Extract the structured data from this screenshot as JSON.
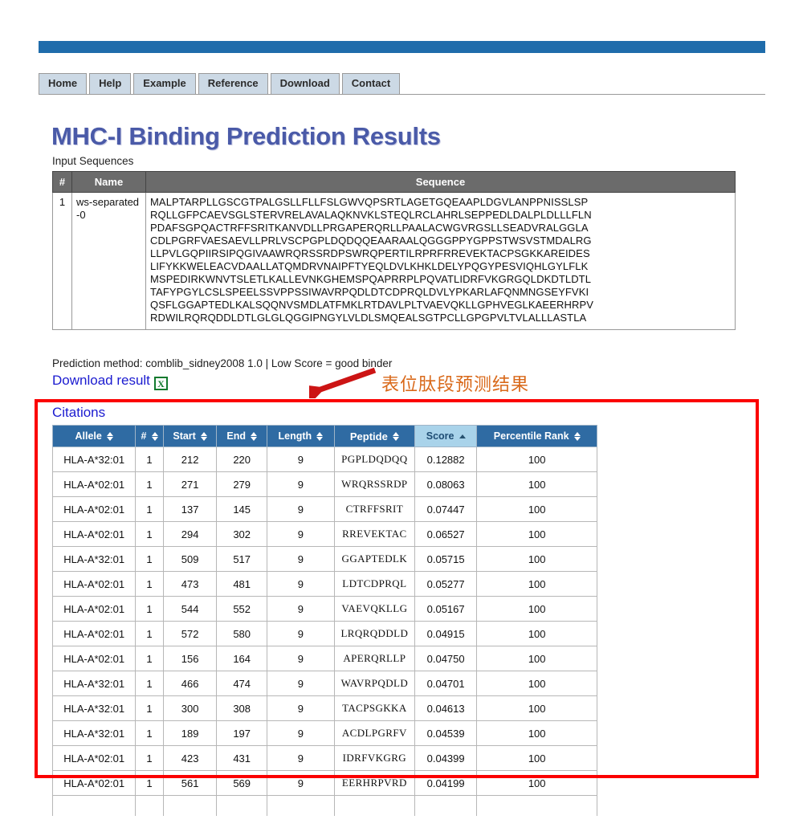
{
  "nav": {
    "tabs": [
      {
        "label": "Home"
      },
      {
        "label": "Help"
      },
      {
        "label": "Example"
      },
      {
        "label": "Reference"
      },
      {
        "label": "Download"
      },
      {
        "label": "Contact"
      }
    ]
  },
  "header": {
    "title": "MHC-I Binding Prediction Results",
    "subhead": "Input Sequences"
  },
  "input_table": {
    "columns": [
      "#",
      "Name",
      "Sequence"
    ],
    "rows": [
      {
        "index": "1",
        "name": "ws-separated-0",
        "sequence_lines": [
          "MALPTARPLLGSCGTPALGSLLFLLFSLGWVQPSRTLAGETGQEAAPLDGVLANPPNISSLSP",
          "RQLLGFPCAEVSGLSTERVRELAVALAQKNVKLSTEQLRCLAHRLSEPPEDLDALPLDLLLFLN",
          "PDAFSGPQACTRFFSRITKANVDLLPRGAPERQRLLPAALACWGVRGSLLSEADVRALGGLA",
          "CDLPGRFVAESAEVLLPRLVSCPGPLDQDQQEAARAALQGGGPPYGPPSTWSVSTMDALRG",
          "LLPVLGQPIIRSIPQGIVAAWRQRSSRDPSWRQPERTILRPRFRREVEKTACPSGKKAREIDES",
          "LIFYKKWELEACVDAALLATQMDRVNAIPFTYEQLDVLKHKLDELYPQGYPESVIQHLGYLFLK",
          "MSPEDIRKWNVTSLETLKALLEVNKGHEMSPQAPRRPLPQVATLIDRFVKGRGQLDKDTLDTL",
          "TAFYPGYLCSLSPEELSSVPPSSIWAVRPQDLDTCDPRQLDVLYPKARLAFQNMNGSEYFVKI",
          "QSFLGGAPTEDLKALSQQNVSMDLATFMKLRTDAVLPLTVAEVQKLLGPHVEGLKAEERHRPV",
          "RDWILRQRQDDLDTLGLGLQGGIPNGYLVLDLSMQEALSGTPCLLGPGPVLTVLALLLASTLA"
        ]
      }
    ]
  },
  "method": {
    "text": "Prediction method: comblib_sidney2008 1.0 | Low Score = good binder",
    "download_label": "Download result",
    "download_icon": "excel-icon",
    "excel_glyph": "X"
  },
  "annotation": {
    "text": "表位肽段预测结果",
    "color": "#d9691a",
    "arrow_color": "#cc1414",
    "highlight_box_color": "#fb0000"
  },
  "results": {
    "citations_label": "Citations",
    "columns": [
      {
        "label": "Allele",
        "sorted": false,
        "sort_dir": "none"
      },
      {
        "label": "#",
        "sorted": false,
        "sort_dir": "none"
      },
      {
        "label": "Start",
        "sorted": false,
        "sort_dir": "none"
      },
      {
        "label": "End",
        "sorted": false,
        "sort_dir": "none"
      },
      {
        "label": "Length",
        "sorted": false,
        "sort_dir": "none"
      },
      {
        "label": "Peptide",
        "sorted": false,
        "sort_dir": "none"
      },
      {
        "label": "Score",
        "sorted": true,
        "sort_dir": "asc"
      },
      {
        "label": "Percentile Rank",
        "sorted": false,
        "sort_dir": "none"
      }
    ],
    "rows": [
      {
        "allele": "HLA-A*32:01",
        "num": "1",
        "start": "212",
        "end": "220",
        "length": "9",
        "peptide": "PGPLDQDQQ",
        "score": "0.12882",
        "rank": "100"
      },
      {
        "allele": "HLA-A*02:01",
        "num": "1",
        "start": "271",
        "end": "279",
        "length": "9",
        "peptide": "WRQRSSRDP",
        "score": "0.08063",
        "rank": "100"
      },
      {
        "allele": "HLA-A*02:01",
        "num": "1",
        "start": "137",
        "end": "145",
        "length": "9",
        "peptide": "CTRFFSRIT",
        "score": "0.07447",
        "rank": "100"
      },
      {
        "allele": "HLA-A*02:01",
        "num": "1",
        "start": "294",
        "end": "302",
        "length": "9",
        "peptide": "RREVEKTAC",
        "score": "0.06527",
        "rank": "100"
      },
      {
        "allele": "HLA-A*32:01",
        "num": "1",
        "start": "509",
        "end": "517",
        "length": "9",
        "peptide": "GGAPTEDLK",
        "score": "0.05715",
        "rank": "100"
      },
      {
        "allele": "HLA-A*02:01",
        "num": "1",
        "start": "473",
        "end": "481",
        "length": "9",
        "peptide": "LDTCDPRQL",
        "score": "0.05277",
        "rank": "100"
      },
      {
        "allele": "HLA-A*02:01",
        "num": "1",
        "start": "544",
        "end": "552",
        "length": "9",
        "peptide": "VAEVQKLLG",
        "score": "0.05167",
        "rank": "100"
      },
      {
        "allele": "HLA-A*02:01",
        "num": "1",
        "start": "572",
        "end": "580",
        "length": "9",
        "peptide": "LRQRQDDLD",
        "score": "0.04915",
        "rank": "100"
      },
      {
        "allele": "HLA-A*02:01",
        "num": "1",
        "start": "156",
        "end": "164",
        "length": "9",
        "peptide": "APERQRLLP",
        "score": "0.04750",
        "rank": "100"
      },
      {
        "allele": "HLA-A*32:01",
        "num": "1",
        "start": "466",
        "end": "474",
        "length": "9",
        "peptide": "WAVRPQDLD",
        "score": "0.04701",
        "rank": "100"
      },
      {
        "allele": "HLA-A*32:01",
        "num": "1",
        "start": "300",
        "end": "308",
        "length": "9",
        "peptide": "TACPSGKKA",
        "score": "0.04613",
        "rank": "100"
      },
      {
        "allele": "HLA-A*32:01",
        "num": "1",
        "start": "189",
        "end": "197",
        "length": "9",
        "peptide": "ACDLPGRFV",
        "score": "0.04539",
        "rank": "100"
      },
      {
        "allele": "HLA-A*02:01",
        "num": "1",
        "start": "423",
        "end": "431",
        "length": "9",
        "peptide": "IDRFVKGRG",
        "score": "0.04399",
        "rank": "100"
      },
      {
        "allele": "HLA-A*02:01",
        "num": "1",
        "start": "561",
        "end": "569",
        "length": "9",
        "peptide": "EERHRPVRD",
        "score": "0.04199",
        "rank": "100"
      }
    ]
  }
}
